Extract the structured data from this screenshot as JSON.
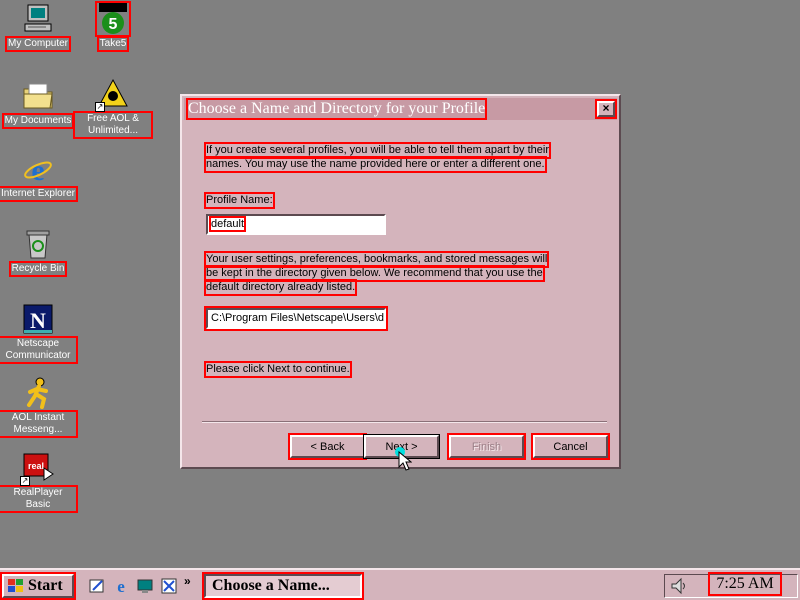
{
  "desktop": {
    "icons": [
      {
        "label": "My Computer"
      },
      {
        "label": "Take5"
      },
      {
        "label": "My Documents"
      },
      {
        "label": "Free AOL & Unlimited..."
      },
      {
        "label": "Internet Explorer"
      },
      {
        "label": "Recycle Bin"
      },
      {
        "label": "Netscape Communicator"
      },
      {
        "label": "AOL Instant Messeng..."
      },
      {
        "label": "RealPlayer Basic"
      }
    ]
  },
  "dialog": {
    "title": "Choose a Name and Directory for your Profile",
    "close_symbol": "×",
    "intro_line1": "If you create several profiles, you will be able to tell them apart by their",
    "intro_line2": "names.  You may use the name provided here or enter a different one.",
    "profile_label": "Profile Name:",
    "profile_value": "default",
    "settings_line1": "Your user settings, preferences, bookmarks, and stored messages will",
    "settings_line2": "be kept in the directory given below.  We recommend that you use the",
    "settings_line3": "default directory already listed.",
    "directory_value": "C:\\Program Files\\Netscape\\Users\\d",
    "continue_text": "Please click Next to continue.",
    "buttons": {
      "back": "< Back",
      "next": "Next >",
      "finish": "Finish",
      "cancel": "Cancel"
    }
  },
  "taskbar": {
    "start_label": "Start",
    "task_label": "Choose a Name...",
    "chevron": "»",
    "clock": "7:25 AM"
  },
  "colors": {
    "desktop": "#808080",
    "dialog_face": "#d4b4bc",
    "titlebar": "#c79aa4",
    "highlight": "#ff0000"
  }
}
